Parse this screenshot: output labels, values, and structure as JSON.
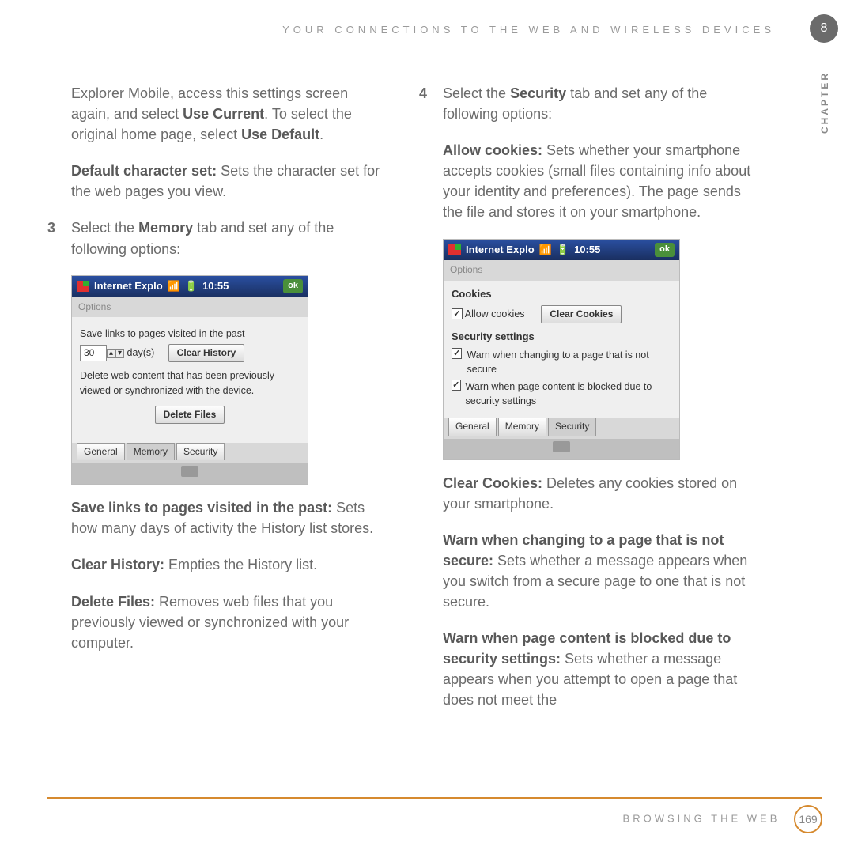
{
  "header": {
    "running_head": "YOUR CONNECTIONS TO THE WEB AND WIRELESS DEVICES",
    "chapter_number": "8",
    "chapter_label": "CHAPTER"
  },
  "col_left": {
    "p1_a": "Explorer Mobile, access this settings screen again, and select ",
    "p1_b": "Use Current",
    "p1_c": ". To select the original home page, select ",
    "p1_d": "Use Default",
    "p1_e": ".",
    "p2_a": "Default character set:",
    "p2_b": " Sets the character set for the web pages you view.",
    "step3_num": "3",
    "step3_a": "Select the ",
    "step3_b": "Memory",
    "step3_c": " tab and set any of the following options:",
    "ss1": {
      "title": "Internet Explo",
      "time": "10:55",
      "ok": "ok",
      "options": "Options",
      "line1": "Save links to pages visited in the past",
      "days_value": "30",
      "days_unit": "day(s)",
      "btn_clear_history": "Clear History",
      "line2": "Delete web content that has been previously viewed or synchronized with the device.",
      "btn_delete_files": "Delete Files",
      "tab_general": "General",
      "tab_memory": "Memory",
      "tab_security": "Security"
    },
    "p3_a": "Save links to pages visited in the past:",
    "p3_b": " Sets how many days of activity the History list stores.",
    "p4_a": "Clear History:",
    "p4_b": " Empties the History list.",
    "p5_a": "Delete Files:",
    "p5_b": " Removes web files that you previously viewed or synchronized with your computer."
  },
  "col_right": {
    "step4_num": "4",
    "step4_a": "Select the ",
    "step4_b": "Security",
    "step4_c": " tab and set any of the following options:",
    "p1_a": "Allow cookies:",
    "p1_b": " Sets whether your smartphone accepts cookies (small files containing info about your identity and preferences). The page sends the file and stores it on your smartphone.",
    "ss2": {
      "title": "Internet Explo",
      "time": "10:55",
      "ok": "ok",
      "options": "Options",
      "section_cookies": "Cookies",
      "allow_cookies": "Allow cookies",
      "btn_clear_cookies": "Clear Cookies",
      "section_security": "Security settings",
      "warn1": "Warn when changing to a page that is not secure",
      "warn2": "Warn when page content is blocked due to security settings",
      "tab_general": "General",
      "tab_memory": "Memory",
      "tab_security": "Security"
    },
    "p2_a": "Clear Cookies:",
    "p2_b": " Deletes any cookies stored on your smartphone.",
    "p3_a": "Warn when changing to a page that is not secure:",
    "p3_b": " Sets whether a message appears when you switch from a secure page to one that is not secure.",
    "p4_a": "Warn when page content is blocked due to security settings:",
    "p4_b": " Sets whether a message appears when you attempt to open a page that does not meet the"
  },
  "footer": {
    "text": "BROWSING THE WEB",
    "page": "169"
  }
}
